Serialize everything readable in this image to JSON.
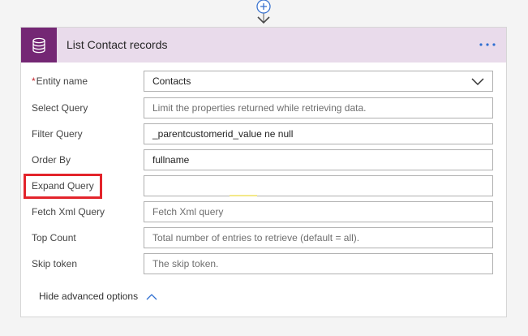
{
  "header": {
    "title": "List Contact records"
  },
  "fields": [
    {
      "label": "Entity name",
      "required": true,
      "value": "Contacts",
      "placeholder": "",
      "type": "select"
    },
    {
      "label": "Select Query",
      "value": "",
      "placeholder": "Limit the properties returned while retrieving data."
    },
    {
      "label": "Filter Query",
      "value": "_parentcustomerid_value ne null",
      "placeholder": ""
    },
    {
      "label": "Order By",
      "value": "fullname",
      "placeholder": ""
    },
    {
      "label": "Expand Query",
      "value": "",
      "placeholder": ""
    },
    {
      "label": "Fetch Xml Query",
      "value": "",
      "placeholder": "Fetch Xml query"
    },
    {
      "label": "Top Count",
      "value": "",
      "placeholder": "Total number of entries to retrieve (default = all)."
    },
    {
      "label": "Skip token",
      "value": "",
      "placeholder": "The skip token."
    }
  ],
  "footer": {
    "hide_advanced_label": "Hide advanced options"
  },
  "colors": {
    "accent": "#742774",
    "header_bg": "#e9dbeb",
    "highlight": "#e3242b",
    "link": "#2f6fd1"
  }
}
